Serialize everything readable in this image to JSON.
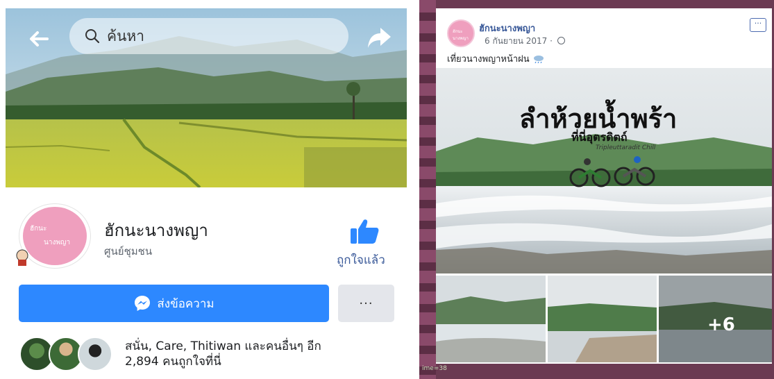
{
  "left_panel": {
    "search": {
      "label": "ค้นหา"
    },
    "page": {
      "name": "ฮักนะนางพญา",
      "category": "ศูนย์ชุมชน",
      "avatar_line1": "ฮักนะ",
      "avatar_line2": "นางพญา"
    },
    "like": {
      "label": "ถูกใจแล้ว",
      "icon": "thumbs-up-icon"
    },
    "message_button": {
      "label": "ส่งข้อความ",
      "icon": "messenger-icon"
    },
    "more_button": {
      "label": "···"
    },
    "likes_summary": {
      "line1": "สนั่น, Care, Thitiwan และคนอื่นๆ อีก",
      "line2": "2,894 คนถูกใจที่นี่"
    },
    "colors": {
      "primary": "#2d88ff",
      "link": "#385898"
    }
  },
  "right_panel": {
    "post": {
      "author": "ฮักนะนางพญา",
      "avatar_text": "ฮักนะนางพญา",
      "date": "6 กันยายน 2017 · ",
      "text": "เที่ยวนางพญาหน้าฝน ",
      "menu_label": "···"
    },
    "photo": {
      "title": "ลำห้วยน้ำพร้า",
      "subtitle": "ที่นี่อุตรดิตถ์",
      "script": "Tripleuttaradit Chill"
    },
    "more_photos": "+6",
    "caption_fragment": "ime=38"
  }
}
